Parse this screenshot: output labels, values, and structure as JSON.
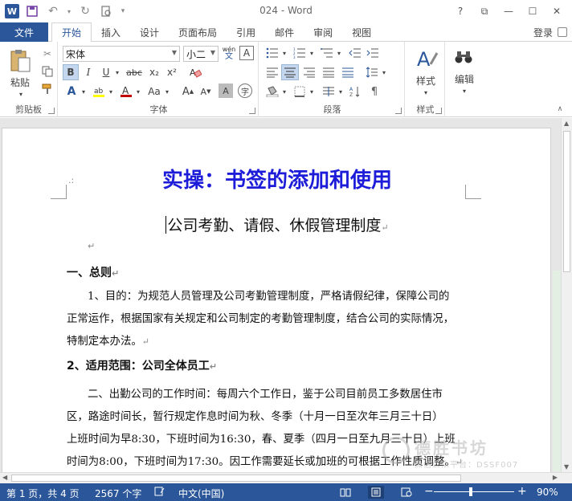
{
  "window": {
    "title": "024 - Word",
    "app_logo": "W",
    "controls": [
      "?",
      "⧉",
      "—",
      "☐",
      "✕"
    ]
  },
  "qat": {
    "icons": [
      "save-icon",
      "undo-icon",
      "redo-icon",
      "print-preview-icon",
      "customize-icon"
    ]
  },
  "tabs": {
    "file": "文件",
    "items": [
      "开始",
      "插入",
      "设计",
      "页面布局",
      "引用",
      "邮件",
      "审阅",
      "视图"
    ],
    "active": "开始",
    "login": "登录"
  },
  "ribbon": {
    "clipboard": {
      "label": "剪贴板",
      "paste": "粘贴"
    },
    "font": {
      "label": "字体",
      "font_name": "宋体",
      "font_size": "小二",
      "bold": "B",
      "italic": "I",
      "underline": "U",
      "strike": "abc",
      "sub": "x₂",
      "sup": "x²",
      "wen": "wén",
      "font_color": "#c00000",
      "highlight": "#ffff00"
    },
    "paragraph": {
      "label": "段落"
    },
    "styles": {
      "label": "样式",
      "button": "样式"
    },
    "editing": {
      "label": "编辑",
      "button": "编辑"
    }
  },
  "document": {
    "heading": "实操：书签的添加和使用",
    "heading_color": "#1c1cd9",
    "subtitle": "公司考勤、请假、休假管理制度",
    "sections": [
      {
        "text": "一、总则",
        "bold": true
      },
      {
        "text": "1、目的：为规范人员管理及公司考勤管理制度，严格请假纪律，保障公司的",
        "bold": false,
        "indent": true
      },
      {
        "text": "正常运作，根据国家有关规定和公司制定的考勤管理制度，结合公司的实际情况，",
        "bold": false
      },
      {
        "text": "特制定本办法。",
        "bold": false
      },
      {
        "text": "2、适用范围：公司全体员工",
        "bold": true
      },
      {
        "text": "二、出勤公司的工作时间：每周六个工作日，鉴于公司目前员工多数居住市",
        "bold": false,
        "indent": true
      },
      {
        "text": "区，路途时间长，暂行规定作息时间为秋、冬季（十月一日至次年三月三十日）",
        "bold": false
      },
      {
        "text": "上班时间为早8:30，下班时间为16:30，春、夏季（四月一日至九月三十日）上班",
        "bold": false
      },
      {
        "text": "时间为8:00，下班时间为17:30。因工作需要延长或加班的可根据工作性质调整。",
        "bold": false
      }
    ],
    "para_mark": "↵"
  },
  "watermark": {
    "title": "德胜书坊",
    "subtitle": "微信公众平台：DSSF007"
  },
  "statusbar": {
    "page": "第 1 页，共 4 页",
    "words": "2567 个字",
    "language": "中文(中国)",
    "zoom": "90%",
    "zoom_minus": "−",
    "zoom_plus": "+"
  }
}
